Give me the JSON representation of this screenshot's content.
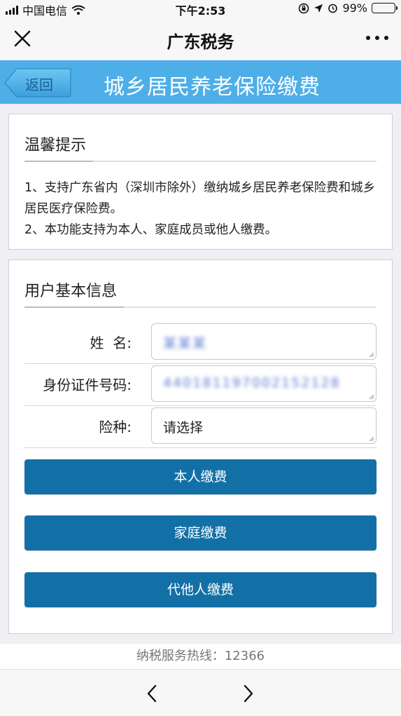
{
  "status_bar": {
    "carrier": "中国电信",
    "time": "下午2:53",
    "battery": "99%"
  },
  "nav": {
    "title": "广东税务",
    "close_icon": "close-icon",
    "more_icon": "more-icon"
  },
  "banner": {
    "back_label": "返回",
    "title": "城乡居民养老保险缴费",
    "color": "#4eaee8"
  },
  "tips": {
    "title": "温馨提示",
    "lines": [
      "1、支持广东省内（深圳市除外）缴纳城乡居民养老保险费和城乡居民医疗保险费。",
      "2、本功能支持为本人、家庭成员或他人缴费。"
    ]
  },
  "user_info": {
    "title": "用户基本信息",
    "fields": [
      {
        "label": "姓  名:",
        "value": "某某某"
      },
      {
        "label": "身份证件号码:",
        "value": "440181197002152128"
      },
      {
        "label": "险种:",
        "value": "请选择"
      }
    ]
  },
  "actions": {
    "self_pay": "本人缴费",
    "family_pay": "家庭缴费",
    "other_pay": "代他人缴费",
    "button_color": "#1370a6"
  },
  "footer": {
    "hotline": "纳税服务热线：12366"
  }
}
